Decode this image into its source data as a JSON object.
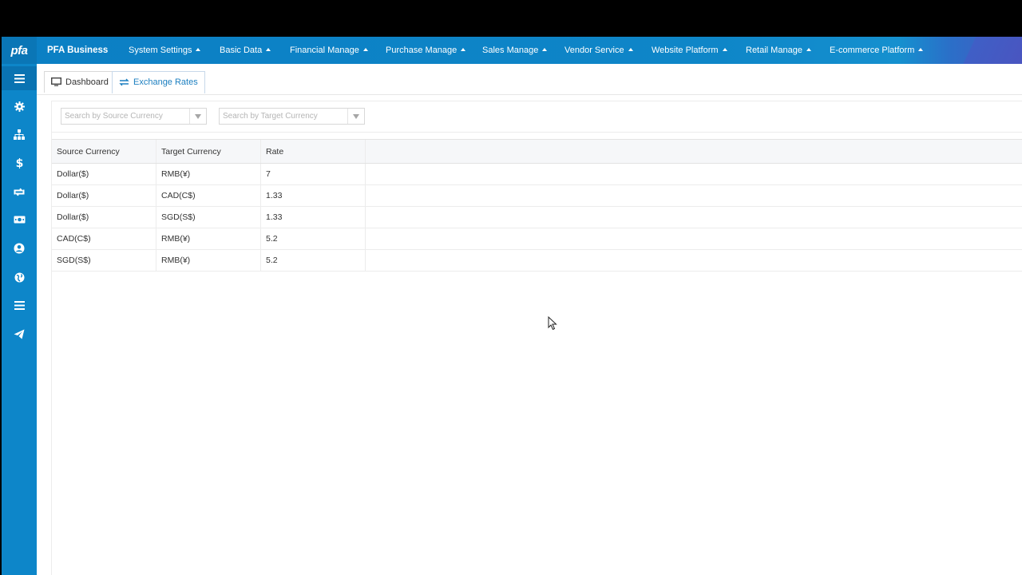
{
  "app": {
    "logo": "pfa",
    "brand": "PFA Business"
  },
  "nav": {
    "items": [
      {
        "label": "System Settings"
      },
      {
        "label": "Basic Data"
      },
      {
        "label": "Financial Manage"
      },
      {
        "label": "Purchase Manage"
      },
      {
        "label": "Sales Manage"
      },
      {
        "label": "Vendor Service"
      },
      {
        "label": "Website Platform"
      },
      {
        "label": "Retail Manage"
      },
      {
        "label": "E-commerce Platform"
      }
    ]
  },
  "sidebar": {
    "icons": [
      "menu-toggle-icon",
      "gear-icon",
      "org-chart-icon",
      "dollar-icon",
      "exchange-icon",
      "money-icon",
      "user-circle-icon",
      "globe-icon",
      "list-icon",
      "send-icon"
    ]
  },
  "tabs": [
    {
      "label": "Dashboard",
      "icon": "monitor-icon",
      "active": false
    },
    {
      "label": "Exchange Rates",
      "icon": "exchange-icon",
      "active": true
    }
  ],
  "filters": {
    "source_placeholder": "Search by Source Currency",
    "target_placeholder": "Search by Target Currency"
  },
  "grid": {
    "columns": [
      "Source Currency",
      "Target Currency",
      "Rate"
    ],
    "rows": [
      [
        "Dollar($)",
        "RMB(¥)",
        "7"
      ],
      [
        "Dollar($)",
        "CAD(C$)",
        "1.33"
      ],
      [
        "Dollar($)",
        "SGD(S$)",
        "1.33"
      ],
      [
        "CAD(C$)",
        "RMB(¥)",
        "5.2"
      ],
      [
        "SGD(S$)",
        "RMB(¥)",
        "5.2"
      ]
    ]
  },
  "colors": {
    "primary": "#0d86c9",
    "active_tab_text": "#1c7fc0"
  }
}
